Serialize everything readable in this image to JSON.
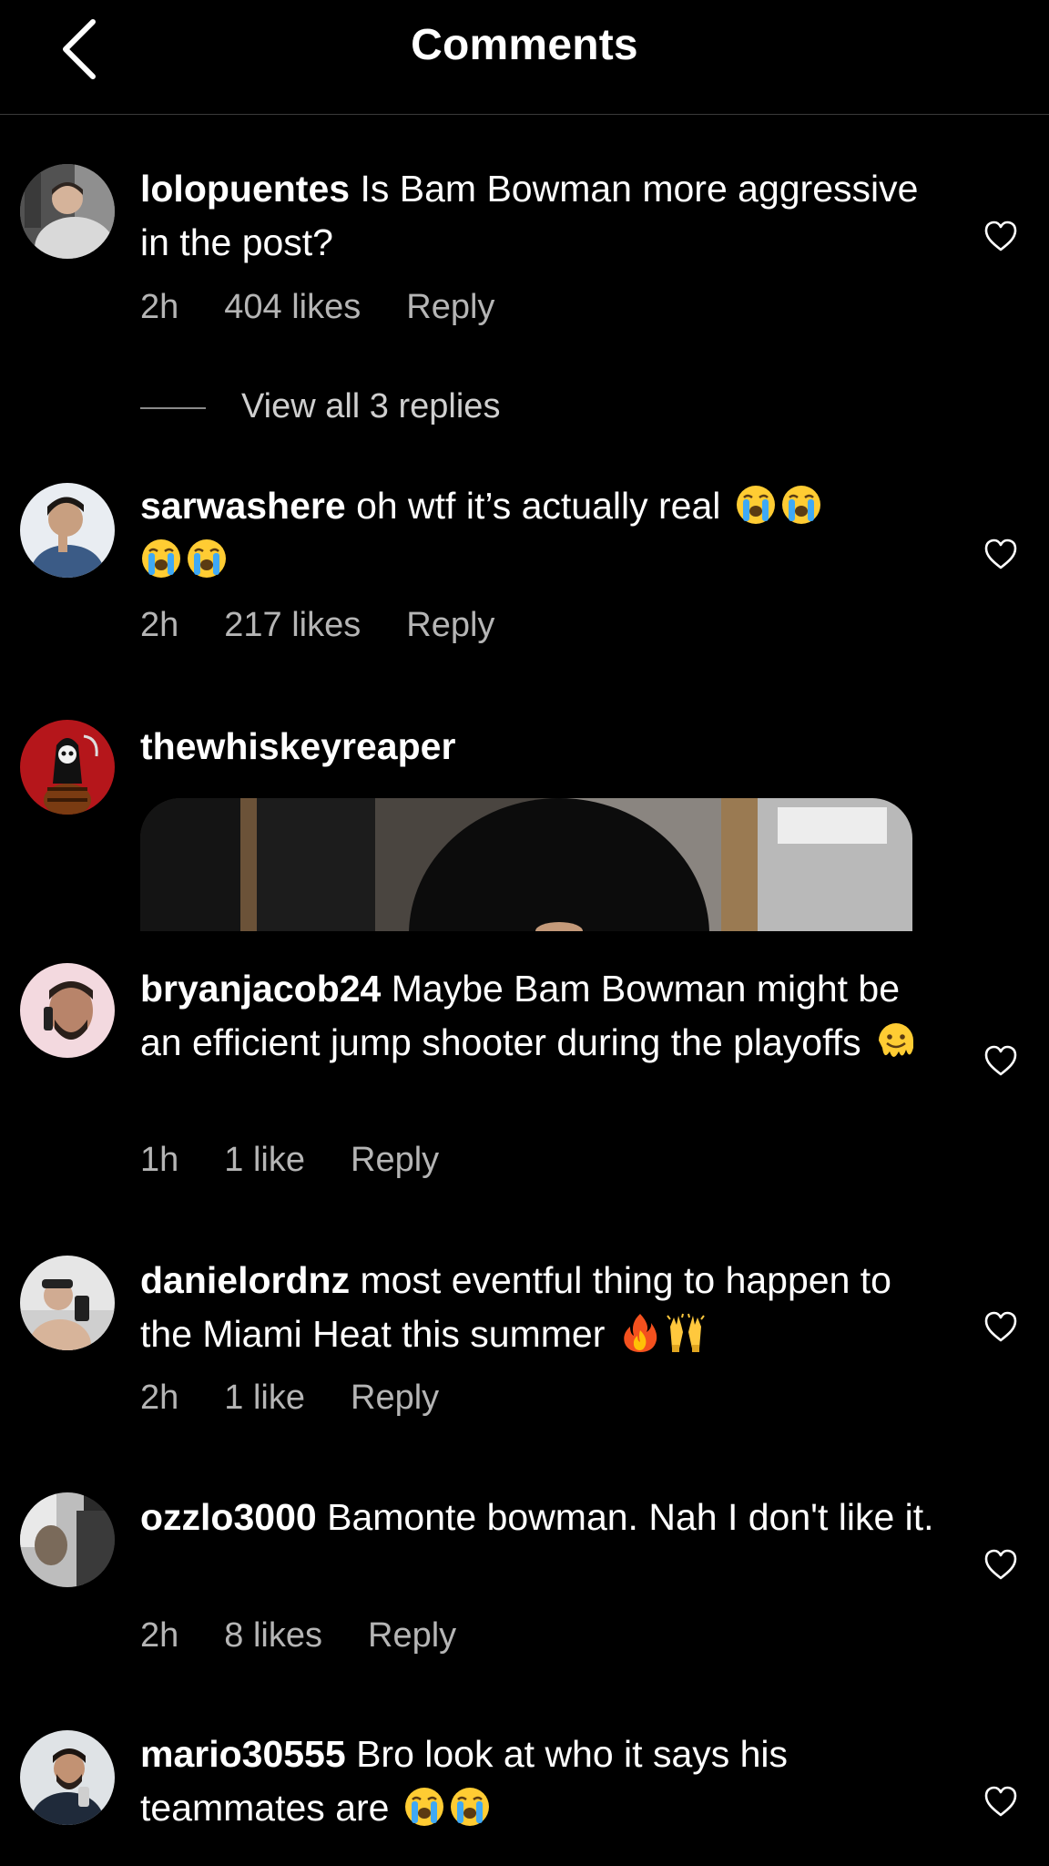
{
  "header": {
    "title": "Comments",
    "back_icon": "chevron-left-icon"
  },
  "comments": [
    {
      "username": "lolopuentes",
      "text": " Is Bam Bowman more aggressive in the post?",
      "time": "2h",
      "likes": "404 likes",
      "reply": "Reply",
      "view_replies": "View all 3 replies"
    },
    {
      "username": "sarwashere",
      "text": " oh wtf it’s actually real",
      "emojis": [
        "loudly-crying-face",
        "loudly-crying-face",
        "loudly-crying-face",
        "loudly-crying-face"
      ],
      "time": "2h",
      "likes": "217 likes",
      "reply": "Reply"
    },
    {
      "username": "thewhiskeyreaper",
      "media": "gif-image"
    },
    {
      "username": "bryanjacob24",
      "text": " Maybe Bam Bowman might be an efficient jump shooter during the playoffs",
      "emojis": [
        "melting-face"
      ],
      "time": "1h",
      "likes": "1 like",
      "reply": "Reply"
    },
    {
      "username": "danielordnz",
      "text": " most eventful thing to happen to the Miami Heat this summer",
      "emojis": [
        "fire",
        "raising-hands"
      ],
      "time": "2h",
      "likes": "1 like",
      "reply": "Reply"
    },
    {
      "username": "ozzlo3000",
      "text": " Bamonte bowman. Nah I don't like it.",
      "time": "2h",
      "likes": "8 likes",
      "reply": "Reply"
    },
    {
      "username": "mario30555",
      "text": " Bro look at who it says his teammates are",
      "emojis": [
        "loudly-crying-face",
        "loudly-crying-face"
      ]
    }
  ],
  "icons": {
    "like": "heart-outline-icon"
  },
  "colors": {
    "background": "#000000",
    "text": "#ffffff",
    "secondary_text": "#b5b5b5",
    "divider": "#3a3a3a"
  }
}
